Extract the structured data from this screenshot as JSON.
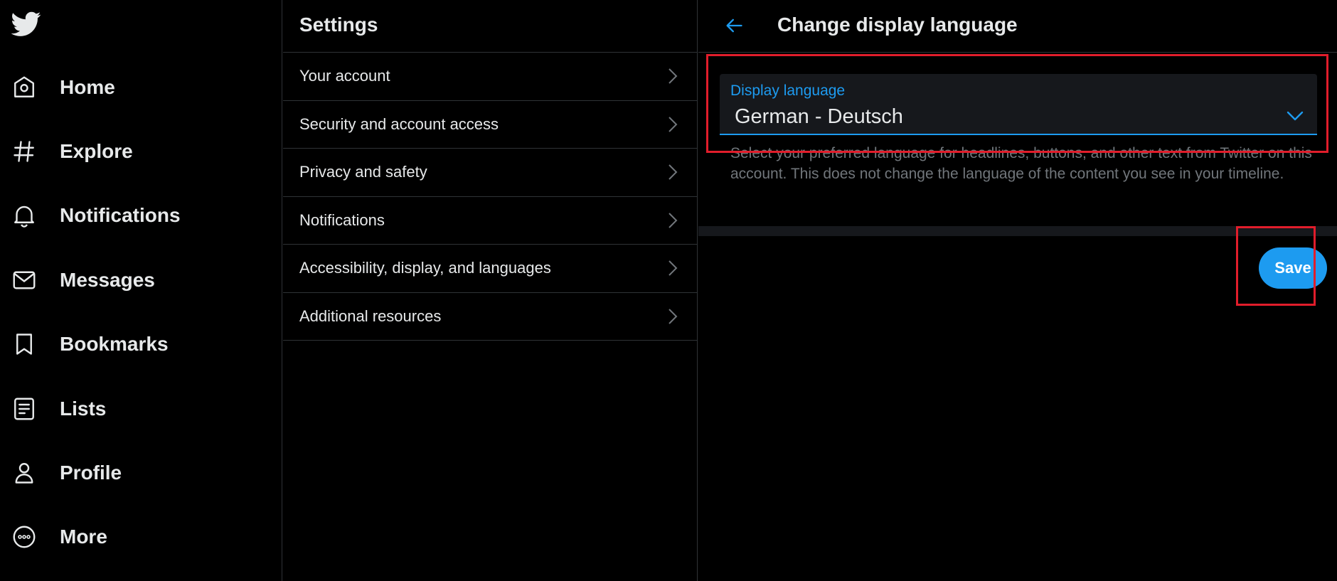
{
  "colors": {
    "background": "#000000",
    "border": "#2f3336",
    "text_primary": "#e7e9ea",
    "text_secondary": "#71767b",
    "accent": "#1d9bf0",
    "field_bg": "#16181c",
    "highlight": "#e11d2b"
  },
  "nav": {
    "logo_icon": "twitter-bird-icon",
    "items": [
      {
        "label": "Home",
        "icon": "home-icon"
      },
      {
        "label": "Explore",
        "icon": "hashtag-icon"
      },
      {
        "label": "Notifications",
        "icon": "bell-icon"
      },
      {
        "label": "Messages",
        "icon": "envelope-icon"
      },
      {
        "label": "Bookmarks",
        "icon": "bookmark-icon"
      },
      {
        "label": "Lists",
        "icon": "list-icon"
      },
      {
        "label": "Profile",
        "icon": "person-icon"
      },
      {
        "label": "More",
        "icon": "more-circle-icon"
      }
    ]
  },
  "settings": {
    "title": "Settings",
    "items": [
      {
        "label": "Your account"
      },
      {
        "label": "Security and account access"
      },
      {
        "label": "Privacy and safety"
      },
      {
        "label": "Notifications"
      },
      {
        "label": "Accessibility, display, and languages"
      },
      {
        "label": "Additional resources"
      }
    ]
  },
  "detail": {
    "title": "Change display language",
    "field": {
      "label": "Display language",
      "value": "German - Deutsch"
    },
    "helper_text": "Select your preferred language for headlines, buttons, and other text from Twitter on this account. This does not change the language of the content you see in your timeline.",
    "save_label": "Save"
  }
}
